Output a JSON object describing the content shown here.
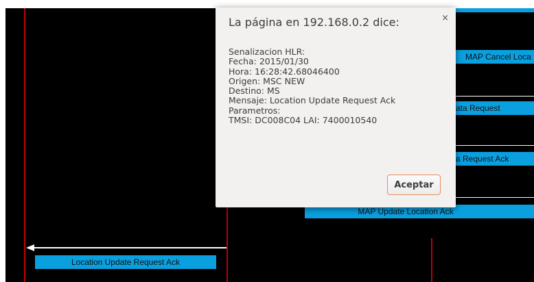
{
  "diagram": {
    "messages": [
      {
        "label": "MAP Cancel Loca",
        "style": "right-cut"
      },
      {
        "label": "ata Request",
        "style": "partial"
      },
      {
        "label": "a Request Ack",
        "style": "partial"
      },
      {
        "label": "MAP Update Location Ack",
        "style": "full"
      },
      {
        "label": "Location Update Request Ack",
        "style": "full"
      }
    ],
    "colors": {
      "background": "#000000",
      "lifeline": "#c00000",
      "message_box": "#0aa0e0",
      "arrow": "#ffffff"
    }
  },
  "dialog": {
    "title": "La página en 192.168.0.2 dice:",
    "close_symbol": "×",
    "lines": [
      "Senalizacion HLR:",
      "Fecha: 2015/01/30",
      "Hora: 16:28:42.68046400",
      "Origen: MSC NEW",
      "Destino: MS",
      "Mensaje: Location Update Request Ack",
      "Parametros:",
      "TMSI: DC008C04  LAI: 7400010540"
    ],
    "accept_label": "Aceptar"
  }
}
